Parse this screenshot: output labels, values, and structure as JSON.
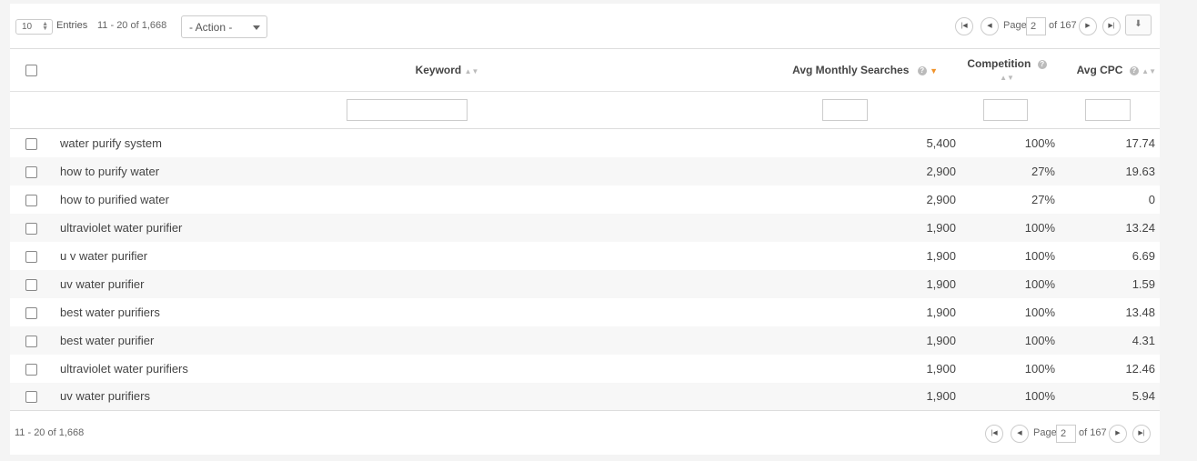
{
  "toolbar": {
    "entries_value": "10",
    "entries_label": "Entries",
    "range": "11 - 20 of 1,668",
    "action_label": "- Action -"
  },
  "pager": {
    "page_label": "Page",
    "current_page": "2",
    "of_label": "of 167"
  },
  "columns": {
    "keyword": "Keyword",
    "avg_monthly": "Avg Monthly Searches",
    "competition": "Competition",
    "avg_cpc": "Avg CPC"
  },
  "sort": {
    "active_column": "Avg Monthly Searches",
    "direction": "descending",
    "accent_color": "#f0932b"
  },
  "rows": [
    {
      "keyword": "water purify system",
      "searches": "5,400",
      "competition": "100%",
      "cpc": "17.74"
    },
    {
      "keyword": "how to purify water",
      "searches": "2,900",
      "competition": "27%",
      "cpc": "19.63"
    },
    {
      "keyword": "how to purified water",
      "searches": "2,900",
      "competition": "27%",
      "cpc": "0"
    },
    {
      "keyword": "ultraviolet water purifier",
      "searches": "1,900",
      "competition": "100%",
      "cpc": "13.24"
    },
    {
      "keyword": "u v water purifier",
      "searches": "1,900",
      "competition": "100%",
      "cpc": "6.69"
    },
    {
      "keyword": "uv water purifier",
      "searches": "1,900",
      "competition": "100%",
      "cpc": "1.59"
    },
    {
      "keyword": "best water purifiers",
      "searches": "1,900",
      "competition": "100%",
      "cpc": "13.48"
    },
    {
      "keyword": "best water purifier",
      "searches": "1,900",
      "competition": "100%",
      "cpc": "4.31"
    },
    {
      "keyword": "ultraviolet water purifiers",
      "searches": "1,900",
      "competition": "100%",
      "cpc": "12.46"
    },
    {
      "keyword": "uv water purifiers",
      "searches": "1,900",
      "competition": "100%",
      "cpc": "5.94"
    }
  ],
  "footer": {
    "range": "11 - 20 of 1,668"
  },
  "icons": {
    "first_page": "first-page-icon",
    "prev_page": "prev-page-icon",
    "next_page": "next-page-icon",
    "last_page": "last-page-icon",
    "export": "download-icon",
    "help": "help-icon",
    "sort": "sort-icon"
  }
}
